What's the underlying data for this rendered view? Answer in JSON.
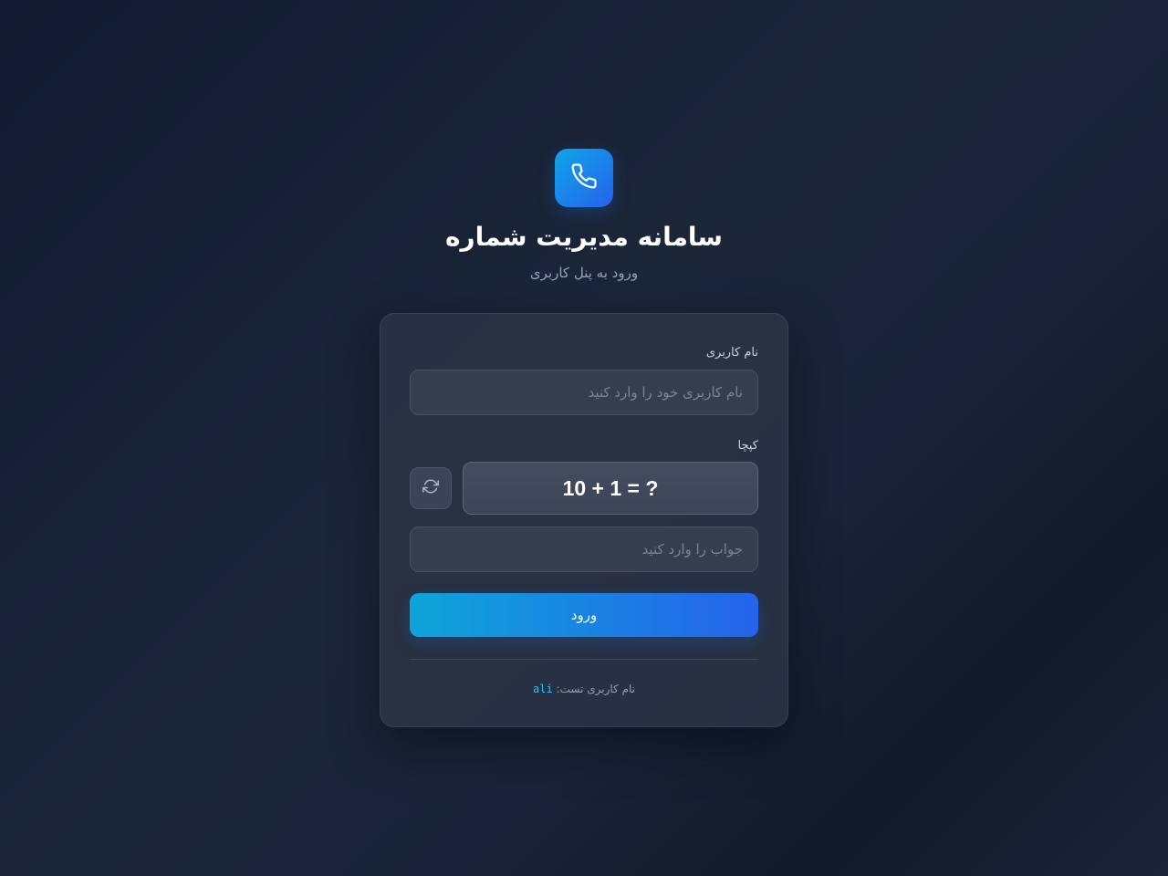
{
  "app": {
    "title": "سامانه مدیریت شماره",
    "subtitle": "ورود به پنل کاربری",
    "logo_icon": "phone-icon"
  },
  "form": {
    "username_label": "نام کاربری",
    "username_placeholder": "نام کاربری خود را وارد کنید",
    "username_value": "",
    "captcha_label": "کپچا",
    "captcha_question": "10 + 1 = ?",
    "refresh_icon": "refresh-icon",
    "answer_placeholder": "جواب را وارد کنید",
    "answer_value": "",
    "submit_label": "ورود"
  },
  "hint": {
    "prefix": "نام کاربری تست:",
    "username": "ali"
  },
  "colors": {
    "accent_start": "#0ea5d9",
    "accent_end": "#2563eb",
    "hint_code": "#38bdf8",
    "background": "#1c2639"
  }
}
